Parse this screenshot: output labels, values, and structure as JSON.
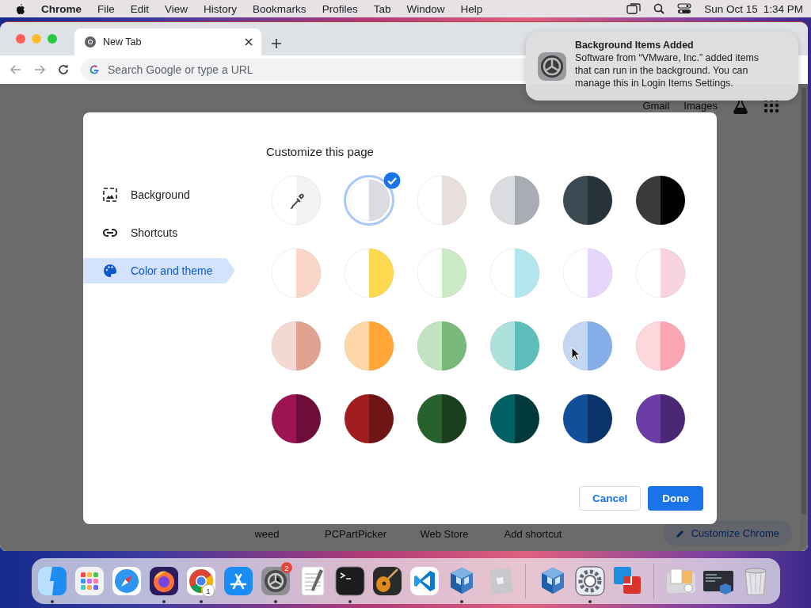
{
  "menu_bar": {
    "app": "Chrome",
    "menus": [
      "File",
      "Edit",
      "View",
      "History",
      "Bookmarks",
      "Profiles",
      "Tab",
      "Window",
      "Help"
    ],
    "date": "Sun Oct 15",
    "time": "1:34 PM"
  },
  "tabs": [
    {
      "title": "New Tab",
      "selected": true
    }
  ],
  "address_bar": {
    "placeholder": "Search Google or type a URL"
  },
  "notification": {
    "title": "Background Items Added",
    "body": "Software from “VMware, Inc.” added items that can run in the background. You can manage this in Login Items Settings."
  },
  "page": {
    "links": [
      "Gmail",
      "Images"
    ],
    "shortcuts": [
      "weed",
      "PCPartPicker",
      "Web Store",
      "Add shortcut"
    ],
    "customize_button": "Customize Chrome"
  },
  "dialog": {
    "title": "Customize this page",
    "sidebar": [
      {
        "kind": "background",
        "label": "Background",
        "selected": false
      },
      {
        "kind": "shortcuts",
        "label": "Shortcuts",
        "selected": false
      },
      {
        "kind": "theme",
        "label": "Color and theme",
        "selected": true
      }
    ],
    "swatches": [
      {
        "kind": "custom",
        "halves": [
          {
            "color": "#ffffff"
          },
          {
            "color": "#f1f3f4"
          }
        ],
        "selected": false
      },
      {
        "kind": "color",
        "halves": [
          {
            "color": "#ffffff"
          },
          {
            "color": "#dadce0"
          }
        ],
        "selected": true
      },
      {
        "kind": "color",
        "halves": [
          {
            "color": "#ffffff"
          },
          {
            "color": "#e8dedc"
          }
        ],
        "selected": false
      },
      {
        "kind": "color",
        "halves": [
          {
            "color": "#dadce0"
          },
          {
            "color": "#a9acb4"
          }
        ],
        "selected": false
      },
      {
        "kind": "color",
        "halves": [
          {
            "color": "#3c4a53"
          },
          {
            "color": "#283339"
          }
        ],
        "selected": false
      },
      {
        "kind": "color",
        "halves": [
          {
            "color": "#3a3a3a"
          },
          {
            "color": "#000000"
          }
        ],
        "selected": false
      },
      {
        "kind": "color",
        "halves": [
          {
            "color": "#ffffff"
          },
          {
            "color": "#fad6c8"
          }
        ],
        "selected": false
      },
      {
        "kind": "color",
        "halves": [
          {
            "color": "#ffffff"
          },
          {
            "color": "#fdd94f"
          }
        ],
        "selected": false
      },
      {
        "kind": "color",
        "halves": [
          {
            "color": "#ffffff"
          },
          {
            "color": "#cdeac7"
          }
        ],
        "selected": false
      },
      {
        "kind": "color",
        "halves": [
          {
            "color": "#ffffff"
          },
          {
            "color": "#b3e5ec"
          }
        ],
        "selected": false
      },
      {
        "kind": "color",
        "halves": [
          {
            "color": "#ffffff"
          },
          {
            "color": "#e7d6fb"
          }
        ],
        "selected": false
      },
      {
        "kind": "color",
        "halves": [
          {
            "color": "#ffffff"
          },
          {
            "color": "#f8d3e0"
          }
        ],
        "selected": false
      },
      {
        "kind": "color",
        "halves": [
          {
            "color": "#f3d9d2"
          },
          {
            "color": "#e0a392"
          }
        ],
        "selected": false
      },
      {
        "kind": "color",
        "halves": [
          {
            "color": "#fed7a8"
          },
          {
            "color": "#ffa637"
          }
        ],
        "selected": false
      },
      {
        "kind": "color",
        "halves": [
          {
            "color": "#c2e2c2"
          },
          {
            "color": "#79ba7c"
          }
        ],
        "selected": false
      },
      {
        "kind": "color",
        "halves": [
          {
            "color": "#aee0dc"
          },
          {
            "color": "#5dbdba"
          }
        ],
        "selected": false
      },
      {
        "kind": "color",
        "halves": [
          {
            "color": "#c5d6f2"
          },
          {
            "color": "#86aee8"
          }
        ],
        "selected": false
      },
      {
        "kind": "color",
        "halves": [
          {
            "color": "#fed7dd"
          },
          {
            "color": "#fda6b3"
          }
        ],
        "selected": false
      },
      {
        "kind": "color",
        "halves": [
          {
            "color": "#9c1454"
          },
          {
            "color": "#6f0d3a"
          }
        ],
        "selected": false
      },
      {
        "kind": "color",
        "halves": [
          {
            "color": "#a21e1e"
          },
          {
            "color": "#701515"
          }
        ],
        "selected": false
      },
      {
        "kind": "color",
        "halves": [
          {
            "color": "#27612b"
          },
          {
            "color": "#1b3f1c"
          }
        ],
        "selected": false
      },
      {
        "kind": "color",
        "halves": [
          {
            "color": "#006063"
          },
          {
            "color": "#00393b"
          }
        ],
        "selected": false
      },
      {
        "kind": "color",
        "halves": [
          {
            "color": "#114f9a"
          },
          {
            "color": "#0a3369"
          }
        ],
        "selected": false
      },
      {
        "kind": "color",
        "halves": [
          {
            "color": "#6b3da4"
          },
          {
            "color": "#4b2876"
          }
        ],
        "selected": false
      }
    ],
    "buttons": [
      {
        "kind": "secondary",
        "label": "Cancel"
      },
      {
        "kind": "primary",
        "label": "Done"
      }
    ]
  },
  "dock": {
    "items": [
      {
        "kind": "finder",
        "running": true
      },
      {
        "kind": "launchpad",
        "running": false
      },
      {
        "kind": "safari",
        "running": false
      },
      {
        "kind": "firefox",
        "running": true
      },
      {
        "kind": "chrome",
        "running": true,
        "badge": "1"
      },
      {
        "kind": "appstore",
        "running": false
      },
      {
        "kind": "settings",
        "running": true,
        "badge": "2"
      },
      {
        "kind": "textedit",
        "running": false
      },
      {
        "kind": "terminal",
        "running": true
      },
      {
        "kind": "guitar",
        "running": false
      },
      {
        "kind": "vscode",
        "running": false
      },
      {
        "kind": "cube",
        "running": true
      },
      {
        "kind": "tilted",
        "running": false
      },
      {
        "kind": "separator"
      },
      {
        "kind": "cube",
        "running": false
      },
      {
        "kind": "gearwhite",
        "running": true
      },
      {
        "kind": "squares",
        "running": false
      },
      {
        "kind": "separator"
      },
      {
        "kind": "docstack",
        "running": false
      },
      {
        "kind": "shotstack",
        "running": false
      },
      {
        "kind": "trash",
        "running": false
      }
    ]
  }
}
